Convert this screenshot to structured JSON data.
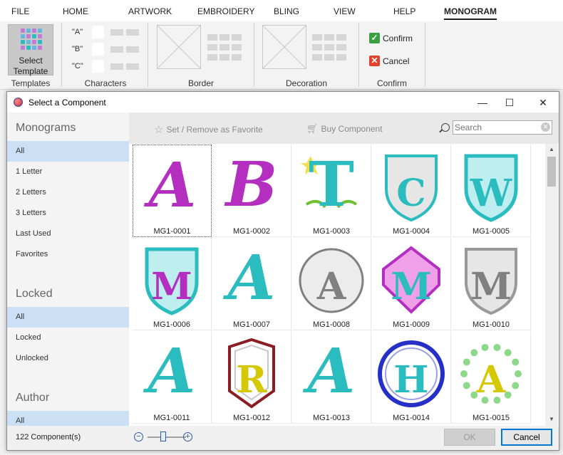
{
  "menu": [
    "FILE",
    "HOME",
    "ARTWORK",
    "EMBROIDERY",
    "BLING",
    "VIEW",
    "HELP",
    "MONOGRAM"
  ],
  "ribbon": {
    "select_template": "Select Template",
    "templates_label": "Templates",
    "characters_label": "Characters",
    "char_a": "\"A\"",
    "char_b": "\"B\"",
    "char_c": "\"C\"",
    "border_label": "Border",
    "decoration_label": "Decoration",
    "confirm": "Confirm",
    "cancel": "Cancel",
    "confirm_group_label": "Confirm"
  },
  "dialog": {
    "title": "Select a Component",
    "minimize": "—",
    "maximize": "☐",
    "close": "✕"
  },
  "sidebar": {
    "monograms_title": "Monograms",
    "monograms_items": [
      "All",
      "1 Letter",
      "2 Letters",
      "3 Letters",
      "Last Used",
      "Favorites"
    ],
    "locked_title": "Locked",
    "locked_items": [
      "All",
      "Locked",
      "Unlocked"
    ],
    "author_title": "Author",
    "author_items": [
      "All"
    ]
  },
  "toolbar": {
    "favorite": "Set / Remove as Favorite",
    "buy": "Buy Component",
    "search_placeholder": "Search"
  },
  "components": [
    {
      "name": "MG1-0001",
      "letter": "A",
      "color": "#b42fc0",
      "shape": "plain"
    },
    {
      "name": "MG1-0002",
      "letter": "B",
      "color": "#b42fc0",
      "shape": "plain"
    },
    {
      "name": "MG1-0003",
      "letter": "T",
      "color": "#2bbcc0",
      "shape": "flower"
    },
    {
      "name": "MG1-0004",
      "letter": "C",
      "color": "#2bbcc0",
      "shape": "shield"
    },
    {
      "name": "MG1-0005",
      "letter": "W",
      "color": "#2bbcc0",
      "shape": "shield-fill"
    },
    {
      "name": "MG1-0006",
      "letter": "M",
      "color": "#b42fc0",
      "shape": "shield-fill"
    },
    {
      "name": "MG1-0007",
      "letter": "A",
      "color": "#2bbcc0",
      "shape": "plain"
    },
    {
      "name": "MG1-0008",
      "letter": "A",
      "color": "#808080",
      "shape": "circle"
    },
    {
      "name": "MG1-0009",
      "letter": "M",
      "color": "#2bbcc0",
      "shape": "diamond"
    },
    {
      "name": "MG1-0010",
      "letter": "M",
      "color": "#808080",
      "shape": "shield"
    },
    {
      "name": "MG1-0011",
      "letter": "A",
      "color": "#2bbcc0",
      "shape": "plain"
    },
    {
      "name": "MG1-0012",
      "letter": "R",
      "color": "#d4c800",
      "shape": "badge"
    },
    {
      "name": "MG1-0013",
      "letter": "A",
      "color": "#2bbcc0",
      "shape": "plain"
    },
    {
      "name": "MG1-0014",
      "letter": "H",
      "color": "#2bbcc0",
      "shape": "ring"
    },
    {
      "name": "MG1-0015",
      "letter": "A",
      "color": "#d4c800",
      "shape": "wreath"
    }
  ],
  "footer": {
    "count": "122 Component(s)",
    "ok": "OK",
    "cancel": "Cancel"
  }
}
